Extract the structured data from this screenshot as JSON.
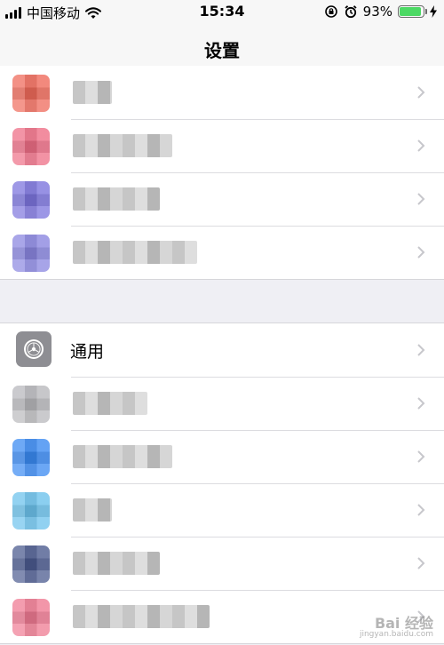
{
  "status_bar": {
    "carrier": "中国移动",
    "time": "15:34",
    "battery_percent": "93%",
    "battery_level": 0.93
  },
  "nav": {
    "title": "设置"
  },
  "group1": {
    "rows": [
      {
        "icon_color": "#ef6a5a",
        "label": ""
      },
      {
        "icon_color": "#ee6e86",
        "label": ""
      },
      {
        "icon_color": "#7c74dd",
        "label": ""
      },
      {
        "icon_color": "#8a86e0",
        "label": ""
      }
    ]
  },
  "group2": {
    "rows": [
      {
        "icon": "gear-icon",
        "icon_color": "#8e8e93",
        "label": "通用"
      },
      {
        "icon_color": "#b8b8bc",
        "label": ""
      },
      {
        "icon_color": "#3a8af2",
        "label": ""
      },
      {
        "icon_color": "#6cc2ec",
        "label": ""
      },
      {
        "icon_color": "#4b5a8f",
        "label": ""
      },
      {
        "icon_color": "#ef7a92",
        "label": ""
      }
    ]
  },
  "watermark": {
    "brand": "Bai 经验",
    "url": "jingyan.baidu.com"
  }
}
